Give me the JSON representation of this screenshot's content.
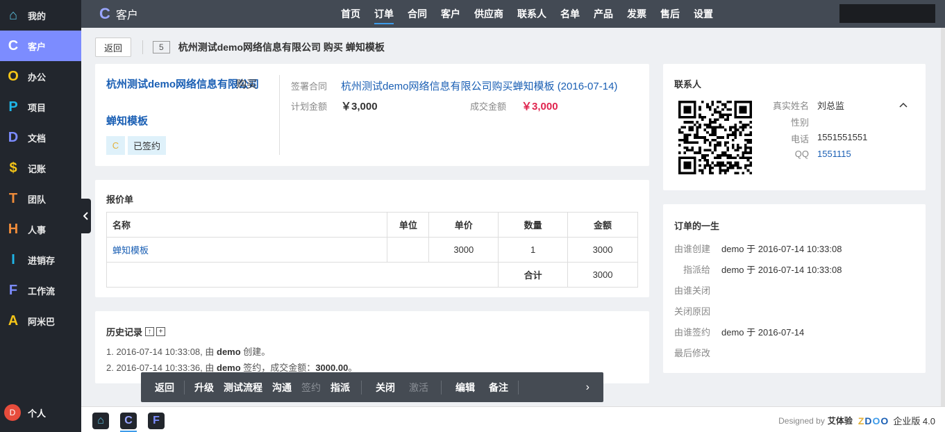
{
  "sidebar": {
    "items": [
      {
        "glyph": "⌂",
        "label": "我的",
        "color": "#5bc0de"
      },
      {
        "glyph": "C",
        "label": "客户",
        "color": "#ffffff"
      },
      {
        "glyph": "O",
        "label": "办公",
        "color": "#f5c518"
      },
      {
        "glyph": "P",
        "label": "项目",
        "color": "#1fb6e8"
      },
      {
        "glyph": "D",
        "label": "文档",
        "color": "#7c8cff"
      },
      {
        "glyph": "$",
        "label": "记账",
        "color": "#f5c518"
      },
      {
        "glyph": "T",
        "label": "团队",
        "color": "#f08c3a"
      },
      {
        "glyph": "H",
        "label": "人事",
        "color": "#f08c3a"
      },
      {
        "glyph": "I",
        "label": "进销存",
        "color": "#1fb6e8"
      },
      {
        "glyph": "F",
        "label": "工作流",
        "color": "#7c8cff"
      },
      {
        "glyph": "A",
        "label": "阿米巴",
        "color": "#f5c518"
      }
    ],
    "personal": {
      "avatar": "D",
      "label": "个人"
    }
  },
  "topbar": {
    "brand_icon": "C",
    "brand": "客户",
    "nav": [
      "首页",
      "订单",
      "合同",
      "客户",
      "供应商",
      "联系人",
      "名单",
      "产品",
      "发票",
      "售后",
      "设置"
    ],
    "active_nav": "订单"
  },
  "breadcrumb": {
    "back": "返回",
    "id": "5",
    "title": "杭州测试demo网络信息有限公司 购买 蝉知模板"
  },
  "order": {
    "customer": "杭州测试demo网络信息有限公司",
    "buy": "购买",
    "product": "蝉知模板",
    "tag_c": "C",
    "status": "已签约",
    "contract_label": "签署合同",
    "contract": "杭州测试demo网络信息有限公司购买蝉知模板 (2016-07-14)",
    "planned_label": "计划金额",
    "planned": "￥3,000",
    "deal_label": "成交金额",
    "deal": "￥3,000"
  },
  "quote": {
    "title": "报价单",
    "headers": [
      "名称",
      "单位",
      "单价",
      "数量",
      "金额"
    ],
    "row": {
      "name": "蝉知模板",
      "unit": "",
      "price": "3000",
      "qty": "1",
      "amount": "3000"
    },
    "total_label": "合计",
    "total": "3000"
  },
  "history": {
    "title": "历史记录",
    "btn_up": "↑",
    "btn_plus": "+",
    "entries": [
      {
        "prefix": "1. 2016-07-14 10:33:08, 由 ",
        "user": "demo",
        "action": " 创建。",
        "amount": "",
        "suffix": ""
      },
      {
        "prefix": "2. 2016-07-14 10:33:36, 由 ",
        "user": "demo",
        "action": " 签约，成交金额：",
        "amount": "3000.00",
        "suffix": "。"
      }
    ]
  },
  "contact": {
    "title": "联系人",
    "name_label": "真实姓名",
    "name": "刘总监",
    "gender_label": "性别",
    "gender": "",
    "phone_label": "电话",
    "phone": "1551551551",
    "qq_label": "QQ",
    "qq": "1551115",
    "toggle": "^"
  },
  "lifecycle": {
    "title": "订单的一生",
    "rows": [
      {
        "label": "由谁创建",
        "value": "demo 于 2016-07-14 10:33:08"
      },
      {
        "label": "指派给",
        "value": "demo 于 2016-07-14 10:33:08"
      },
      {
        "label": "由谁关闭",
        "value": ""
      },
      {
        "label": "关闭原因",
        "value": ""
      },
      {
        "label": "由谁签约",
        "value": "demo 于 2016-07-14"
      },
      {
        "label": "最后修改",
        "value": ""
      }
    ]
  },
  "actions": {
    "back": "返回",
    "upgrade": "升级",
    "test_flow": "测试流程",
    "communicate": "沟通",
    "sign": "签约",
    "assign": "指派",
    "close": "关闭",
    "activate": "激活",
    "edit": "编辑",
    "note": "备注",
    "more": "›"
  },
  "footer": {
    "designed_by": "Designed by",
    "company": "艾体验",
    "logo": [
      "Z",
      "D",
      "O",
      "O"
    ],
    "edition": "企业版 4.0",
    "dock": [
      "⌂",
      "C",
      "F"
    ]
  }
}
